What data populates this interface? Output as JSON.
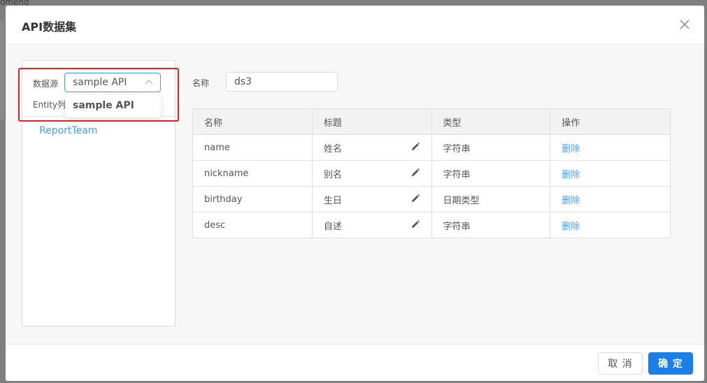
{
  "background": {
    "partial_text": "omend"
  },
  "dialog": {
    "title": "API数据集"
  },
  "left_panel": {
    "datasource_label": "数据源",
    "datasource_value": "sample API",
    "entity_label": "Entity列",
    "dropdown_options": [
      "sample API"
    ],
    "entities": [
      "ReportTeam"
    ]
  },
  "form": {
    "name_label": "名称",
    "name_value": "ds3"
  },
  "table": {
    "headers": [
      "名称",
      "标题",
      "类型",
      "操作"
    ],
    "rows": [
      {
        "name": "name",
        "title": "姓名",
        "type": "字符串",
        "action": "删除"
      },
      {
        "name": "nickname",
        "title": "别名",
        "type": "字符串",
        "action": "删除"
      },
      {
        "name": "birthday",
        "title": "生日",
        "type": "日期类型",
        "action": "删除"
      },
      {
        "name": "desc",
        "title": "自述",
        "type": "字符串",
        "action": "删除"
      }
    ]
  },
  "footer": {
    "cancel_label": "取 消",
    "ok_label": "确 定"
  },
  "icons": {
    "close": "close-icon",
    "edit": "pencil-icon",
    "arrow": "chevron-up-icon"
  },
  "colors": {
    "primary": "#1b7fe8",
    "link": "#409eff",
    "highlight_box": "#e8201a"
  }
}
